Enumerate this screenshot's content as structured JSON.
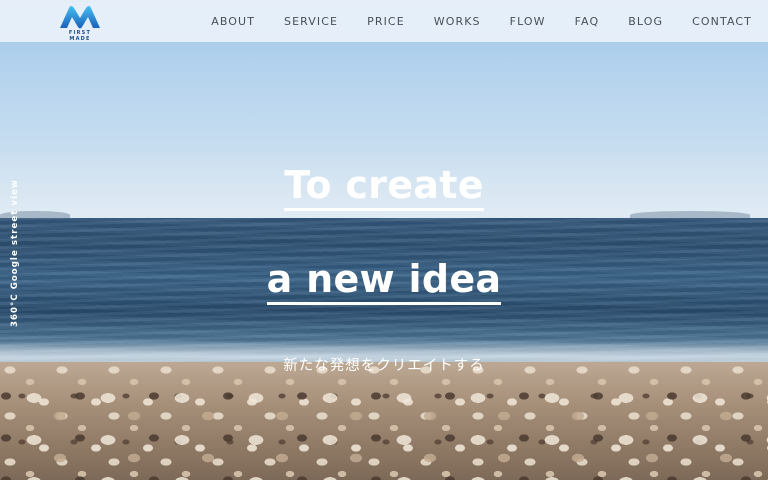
{
  "header": {
    "logo_text": "FIRST MADE",
    "nav": [
      "ABOUT",
      "SERVICE",
      "PRICE",
      "WORKS",
      "FLOW",
      "FAQ",
      "BLOG",
      "CONTACT"
    ]
  },
  "side_label": "360°C Google street view",
  "hero": {
    "line1": "To create",
    "line2": "a new idea",
    "subtitle": "新たな発想をクリエイトする"
  },
  "colors": {
    "logo_gradient_start": "#3fb6ef",
    "logo_gradient_end": "#1a5fb8",
    "nav_text": "#4a4f56",
    "header_bg": "#eef4fa"
  },
  "icons": {
    "logo": "m-wave-logo"
  }
}
